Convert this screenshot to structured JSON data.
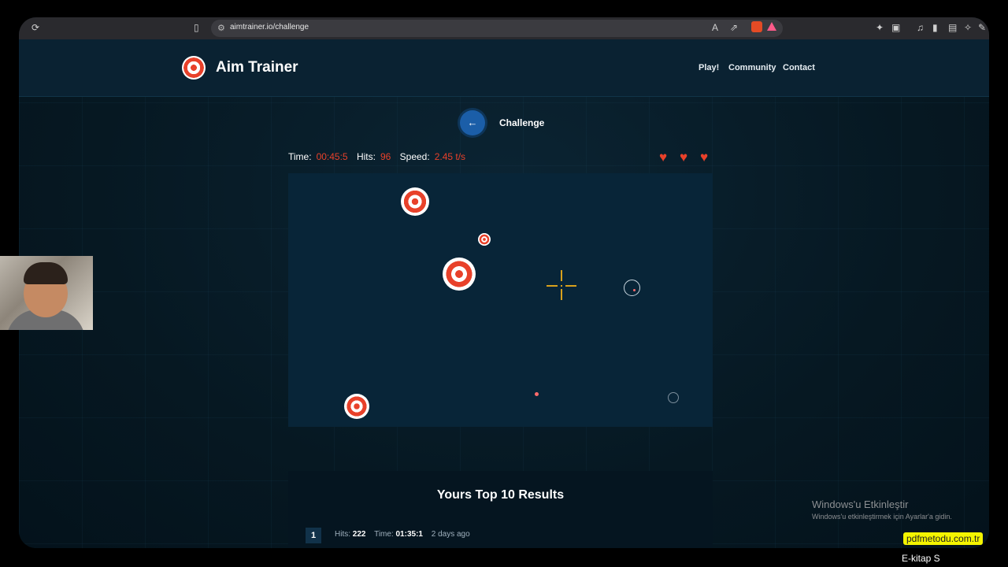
{
  "browser": {
    "url": "aimtrainer.io/challenge"
  },
  "header": {
    "brand": "Aim Trainer",
    "nav": [
      "Play!",
      "Community",
      "Contact"
    ]
  },
  "challenge": {
    "back_icon": "←",
    "title": "Challenge"
  },
  "stats": {
    "time_label": "Time:",
    "time_value": "00:45:5",
    "hits_label": "Hits:",
    "hits_value": "96",
    "speed_label": "Speed:",
    "speed_value": "2.45 t/s",
    "lives": 3
  },
  "results": {
    "title": "Yours Top 10 Results",
    "rows": [
      {
        "rank": "1",
        "hits_label": "Hits:",
        "hits": "222",
        "time_label": "Time:",
        "time": "01:35:1",
        "ago": "2 days ago"
      }
    ]
  },
  "overlay": {
    "activate_title": "Windows'u Etkinleştir",
    "activate_sub": "Windows'u etkinleştirmek için Ayarlar'a gidin.",
    "watermark": "pdfmetodu.com.tr",
    "caption": "E-kitap S"
  },
  "colors": {
    "accent_red": "#e8412a",
    "button_blue": "#1b5ea8",
    "arena_bg": "#082538",
    "crosshair": "#d9a11c"
  }
}
